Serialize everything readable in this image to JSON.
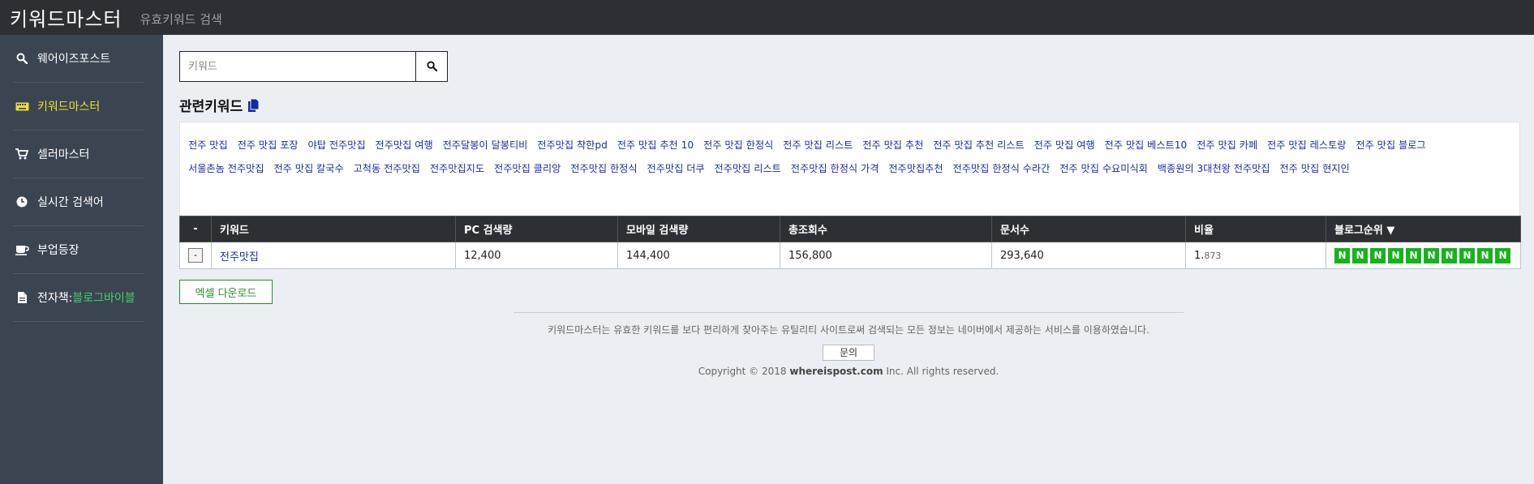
{
  "header": {
    "brand": "키워드마스터",
    "subtitle": "유효키워드 검색"
  },
  "sidebar": {
    "items": [
      {
        "label": "웨어이즈포스트",
        "icon": "search-icon"
      },
      {
        "label": "키워드마스터",
        "icon": "keyboard-icon",
        "active": true
      },
      {
        "label": "셀러마스터",
        "icon": "cart-icon"
      },
      {
        "label": "실시간 검색어",
        "icon": "clock-icon"
      },
      {
        "label": "부업등장",
        "icon": "coffee-icon"
      },
      {
        "label": "전자책: ",
        "accent": "블로그바이블",
        "icon": "file-icon"
      }
    ]
  },
  "search": {
    "placeholder": "키워드",
    "value": ""
  },
  "related": {
    "title": "관련키워드",
    "keywords": [
      "전주 맛집",
      "전주 맛집 포장",
      "야탑 전주맛집",
      "전주맛집 여행",
      "전주달봉이 달봉티비",
      "전주맛집 착한pd",
      "전주 맛집 추천 10",
      "전주 맛집 한정식",
      "전주 맛집 리스트",
      "전주 맛집 추천",
      "전주 맛집 추천 리스트",
      "전주 맛집 여행",
      "전주 맛집 베스트10",
      "전주 맛집 카페",
      "전주 맛집 레스토랑",
      "전주 맛집 블로그",
      "서울촌놈 전주맛집",
      "전주 맛집 칼국수",
      "고척동 전주맛집",
      "전주맛집지도",
      "전주맛집 클리앙",
      "전주맛집 한정식",
      "전주맛집 더쿠",
      "전주맛집 리스트",
      "전주맛집 한정식 가격",
      "전주맛집추천",
      "전주맛집 한정식 수라간",
      "전주 맛집 수요미식회",
      "백종원의 3대천왕 전주맛집",
      "전주 맛집 현지인"
    ]
  },
  "table": {
    "headers": [
      "-",
      "키워드",
      "PC 검색량",
      "모바일 검색량",
      "총조회수",
      "문서수",
      "비율",
      "블로그순위 ▼"
    ],
    "rows": [
      {
        "toggle": "-",
        "keyword": "전주맛집",
        "pc": "12,400",
        "mobile": "144,400",
        "total": "156,800",
        "docs": "293,640",
        "ratio_main": "1.",
        "ratio_dec": "873",
        "blog_rank": [
          "N",
          "N",
          "N",
          "N",
          "N",
          "N",
          "N",
          "N",
          "N",
          "N"
        ]
      }
    ]
  },
  "excel_label": "엑셀 다운로드",
  "footer": {
    "desc": "키워드마스터는 유효한 키워드를 보다 편리하게 찾아주는 유틸리티 사이트로써 검색되는 모든 정보는 네이버에서 제공하는 서비스를 이용하였습니다.",
    "contact": "문의",
    "copyright_pre": "Copyright © 2018 ",
    "copyright_domain": "whereispost.com",
    "copyright_post": " Inc. All rights reserved."
  },
  "colors": {
    "topbar": "#2c3034",
    "sidebar": "#3b4552",
    "active": "#f1dd38",
    "accent_green": "#46d06a",
    "badge_green": "#17b31d",
    "link": "#1a2eaa"
  }
}
